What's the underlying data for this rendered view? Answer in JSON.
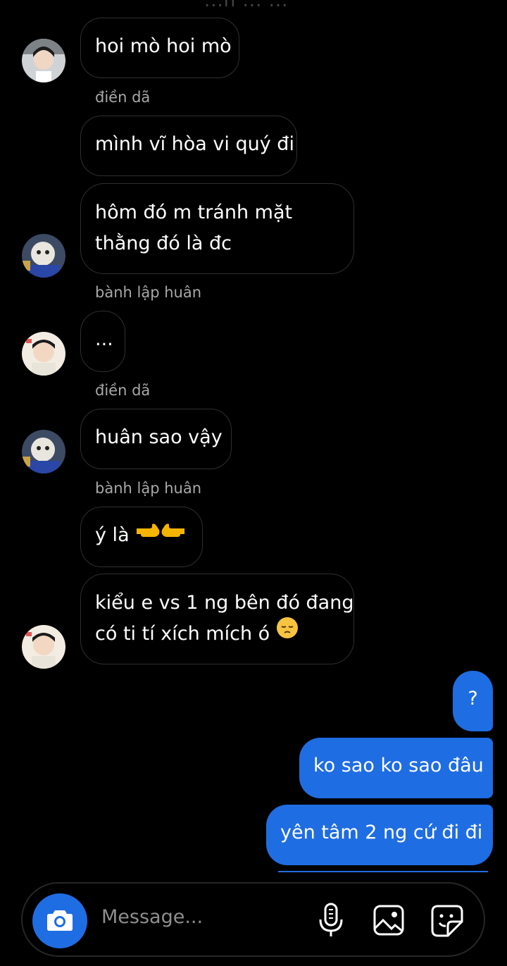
{
  "header": {
    "title_fragment": "...n ... ..."
  },
  "messages": [
    {
      "sender": "",
      "text": "hoi mò hoi mò",
      "direction": "incoming"
    },
    {
      "sender": "điền dã",
      "text": "mình vĩ hòa vi quý đi",
      "direction": "incoming"
    },
    {
      "sender": "",
      "lines": [
        "hôm đó m tránh mặt",
        "thằng đó là đc"
      ],
      "direction": "incoming"
    },
    {
      "sender": "bành lập huân",
      "text": "...",
      "direction": "incoming"
    },
    {
      "sender": "điền dã",
      "text": "huân sao vậy",
      "direction": "incoming"
    },
    {
      "sender": "bành lập huân",
      "text": "ý là",
      "emoji": "pointing-hands",
      "direction": "incoming"
    },
    {
      "sender": "",
      "lines": [
        "kiểu e vs 1 ng bên đó đang",
        "có ti tí xích mích ó"
      ],
      "emoji": "pensive-face",
      "direction": "incoming"
    },
    {
      "sender": "",
      "text": "?",
      "direction": "outgoing"
    },
    {
      "sender": "",
      "text": "ko sao ko sao đâu",
      "direction": "outgoing"
    },
    {
      "sender": "",
      "text": "yên tâm 2 ng cứ đi đi",
      "direction": "outgoing"
    }
  ],
  "composer": {
    "placeholder": "Message...",
    "icons": [
      "camera-icon",
      "microphone-icon",
      "image-icon",
      "sticker-icon"
    ]
  },
  "colors": {
    "background": "#000000",
    "outgoing_bubble": "#1f6de2",
    "incoming_border": "#2f2f2f",
    "secondary_text": "#a8a8a8"
  }
}
